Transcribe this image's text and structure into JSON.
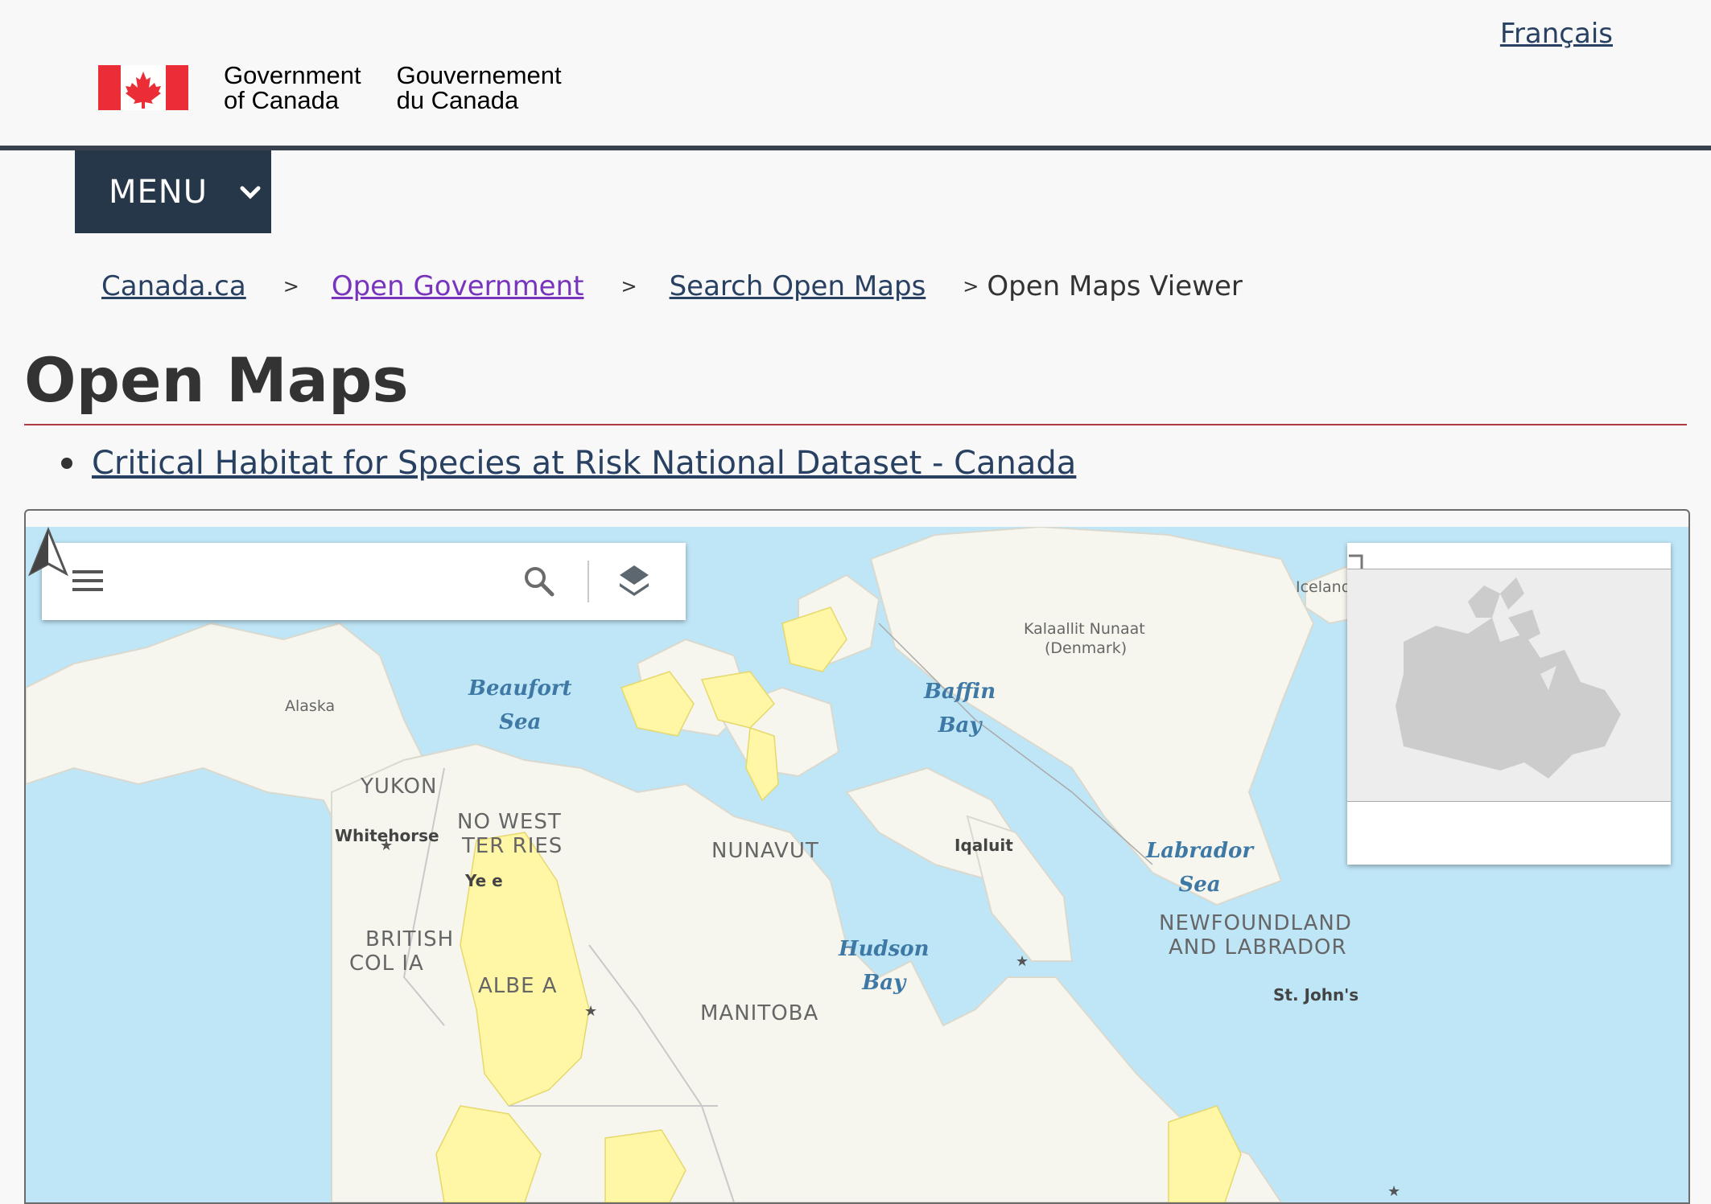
{
  "header": {
    "language_link": "Français",
    "signature_en": "Government\nof Canada",
    "signature_fr": "Gouvernement\ndu Canada",
    "flag_icon": "canada-flag-icon"
  },
  "menu": {
    "label": "MENU",
    "icon": "chevron-down-icon"
  },
  "breadcrumb": {
    "items": [
      "Canada.ca",
      "Open Government",
      "Search Open Maps"
    ],
    "separator": ">",
    "current": "Open Maps Viewer"
  },
  "page": {
    "title": "Open Maps",
    "datasets": [
      "Critical Habitat for Species at Risk National Dataset - Canada"
    ]
  },
  "map": {
    "toolbar_icons": [
      "menu-icon",
      "search-icon",
      "layers-icon"
    ],
    "north_arrow_icon": "north-arrow-icon",
    "water_labels": {
      "beaufort": "Beaufort\nSea",
      "baffin": "Baffin\nBay",
      "labrador": "Labrador\nSea",
      "hudson": "Hudson\nBay"
    },
    "region_labels": {
      "alaska": "Alaska",
      "yukon": "YUKON",
      "nwt1": "NO   WEST",
      "nwt2": "TER     RIES",
      "nunavut": "NUNAVUT",
      "bc1": "BRITISH",
      "bc2": "COL    IA",
      "alberta": "ALBE  A",
      "manitoba": "MANITOBA",
      "nl1": "NEWFOUNDLAND",
      "nl2": "AND   LABRADOR",
      "greenland1": "Kalaallit Nunaat",
      "greenland2": "(Denmark)",
      "iceland": "Iceland"
    },
    "city_labels": {
      "whitehorse": "Whitehorse",
      "iqaluit": "Iqaluit",
      "yellowknife": "Ye      e",
      "stjohns": "St. John's"
    },
    "colors": {
      "water": "#bfe6f7",
      "land": "#f6f6ee",
      "habitat": "#fff6a6",
      "header_rule": "#38414d",
      "menu_bg": "#26374a",
      "title_rule": "#af3c43"
    }
  }
}
